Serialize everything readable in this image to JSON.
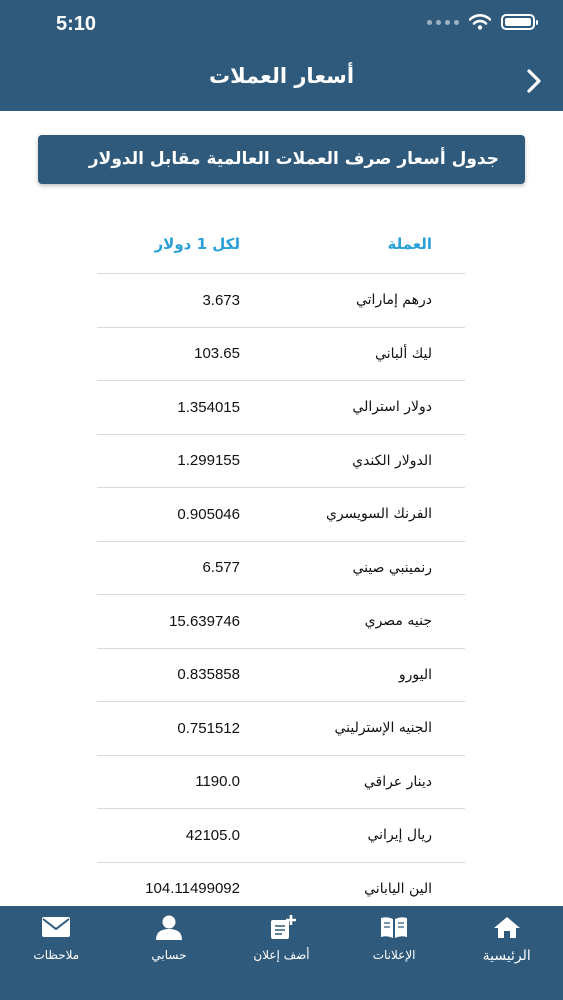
{
  "status_bar": {
    "time": "5:10"
  },
  "header": {
    "title": "أسعار العملات"
  },
  "banner": {
    "text": "جدول أسعار صرف العملات العالمية مقابل الدولار"
  },
  "table": {
    "headers": {
      "currency": "العملة",
      "rate": "لكل 1 دولار"
    },
    "rows": [
      {
        "currency": "درهم إماراتي",
        "rate": "3.673"
      },
      {
        "currency": "ليك ألباني",
        "rate": "103.65"
      },
      {
        "currency": "دولار استرالي",
        "rate": "1.354015"
      },
      {
        "currency": "الدولار الكندي",
        "rate": "1.299155"
      },
      {
        "currency": "الفرنك السويسري",
        "rate": "0.905046"
      },
      {
        "currency": "رنمينبي صيني",
        "rate": "6.577"
      },
      {
        "currency": "جنيه مصري",
        "rate": "15.639746"
      },
      {
        "currency": "اليورو",
        "rate": "0.835858"
      },
      {
        "currency": "الجنيه الإسترليني",
        "rate": "0.751512"
      },
      {
        "currency": "دينار عراقي",
        "rate": "1190.0"
      },
      {
        "currency": "ريال إيراني",
        "rate": "42105.0"
      },
      {
        "currency": "الين الياباني",
        "rate": "104.11499092"
      }
    ]
  },
  "tabbar": {
    "items": [
      {
        "label": "الرئيسية",
        "icon": "home-icon"
      },
      {
        "label": "الإعلانات",
        "icon": "book-icon"
      },
      {
        "label": "أضف إعلان",
        "icon": "add-ad-icon"
      },
      {
        "label": "حسابي",
        "icon": "person-icon"
      },
      {
        "label": "ملاحظات",
        "icon": "mail-icon"
      }
    ]
  },
  "colors": {
    "primary": "#2f5a7c",
    "accent": "#2aa0d8"
  }
}
